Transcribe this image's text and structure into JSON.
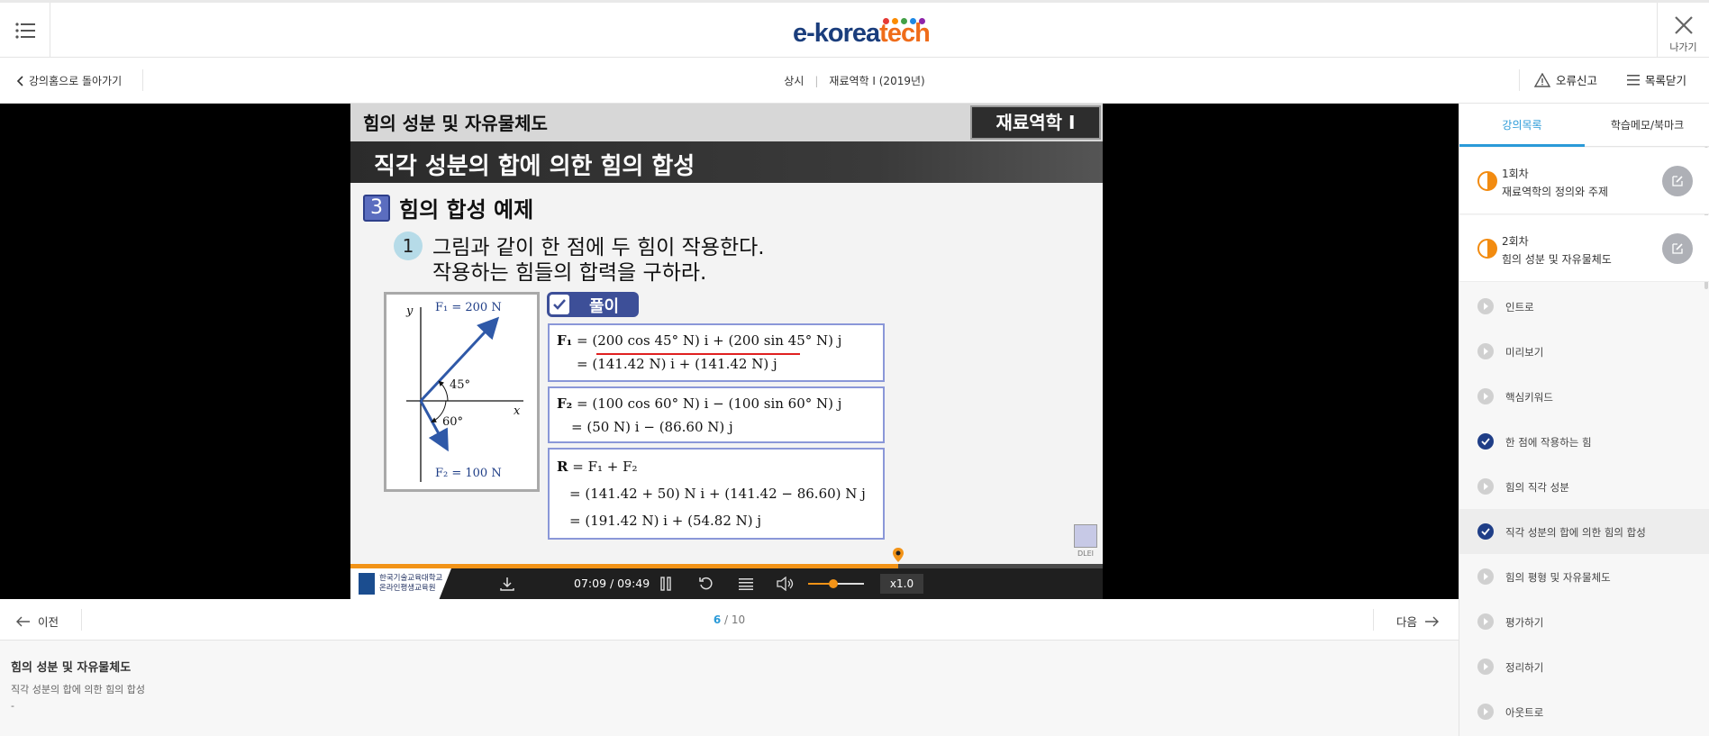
{
  "header": {
    "logo_prefix": "e-korea",
    "logo_suffix": "tech",
    "exit_label": "나가기",
    "logo_dot_colors": [
      "#e53935",
      "#fb8c00",
      "#43a047",
      "#1e88e5",
      "#8e24aa"
    ]
  },
  "subheader": {
    "back_label": "강의홈으로 돌아가기",
    "breadcrumb": [
      "상시",
      "재료역학 I (2019년)"
    ],
    "report_label": "오류신고",
    "close_list_label": "목록닫기"
  },
  "slide": {
    "header_title": "힘의 성분 및 자유물체도",
    "subject_badge": "재료역학 I",
    "band_title": "직각 성분의 합에 의한 힘의 합성",
    "section_number": "3",
    "section_title": "힘의 합성 예제",
    "question_number": "1",
    "question_line1": "그림과 같이 한 점에 두 힘이 작용한다.",
    "question_line2": "작용하는 힘들의 합력을 구하라.",
    "solution_label": "풀이",
    "figure": {
      "y_label": "y",
      "x_label": "x",
      "f1_label": "F₁ = 200 N",
      "f2_label": "F₂ = 100 N",
      "angle1": "45°",
      "angle2": "60°"
    },
    "eq_f1_line1_lhs": "F₁",
    "eq_f1_line1": "= (200 cos 45° N) i + (200 sin 45° N) j",
    "eq_f1_line2": "= (141.42 N) i + (141.42 N) j",
    "eq_f2_line1_lhs": "F₂",
    "eq_f2_line1": "= (100 cos 60° N) i − (100 sin 60° N) j",
    "eq_f2_line2": "= (50 N) i − (86.60 N) j",
    "eq_r_line1_lhs": "R",
    "eq_r_line1": "= F₁ + F₂",
    "eq_r_line2": "= (141.42 + 50) N i + (141.42 − 86.60) N j",
    "eq_r_line3": "= (191.42 N) i + (54.82 N) j",
    "watermark": "DLEI"
  },
  "player": {
    "org_name_line1": "한국기술교육대학교",
    "org_name_line2": "온라인평생교육원",
    "time": "07:09 / 09:49",
    "progress": 0.728,
    "volume": 0.45,
    "speed": "x1.0",
    "accent_color": "#f29317"
  },
  "pager": {
    "prev_label": "이전",
    "next_label": "다음",
    "current": "6",
    "total": "10"
  },
  "info": {
    "title": "힘의 성분 및 자유물체도",
    "subtitle": "직각 성분의 합에 의한 힘의 합성",
    "extra": "-"
  },
  "sidebar": {
    "tabs": [
      "강의목록",
      "학습메모/북마크"
    ],
    "chapters": [
      {
        "number": "1회차",
        "title": "재료역학의 정의와 주제"
      },
      {
        "number": "2회차",
        "title": "힘의 성분 및 자유물체도"
      }
    ],
    "items": [
      {
        "label": "인트로",
        "state": "play"
      },
      {
        "label": "미리보기",
        "state": "play"
      },
      {
        "label": "핵심키워드",
        "state": "play"
      },
      {
        "label": "한 점에 작용하는 힘",
        "state": "done"
      },
      {
        "label": "힘의 직각 성분",
        "state": "play"
      },
      {
        "label": "직각 성분의 합에 의한 힘의 합성",
        "state": "done"
      },
      {
        "label": "힘의 평형 및 자유물체도",
        "state": "play"
      },
      {
        "label": "평가하기",
        "state": "play"
      },
      {
        "label": "정리하기",
        "state": "play"
      },
      {
        "label": "아웃트로",
        "state": "play"
      }
    ]
  }
}
